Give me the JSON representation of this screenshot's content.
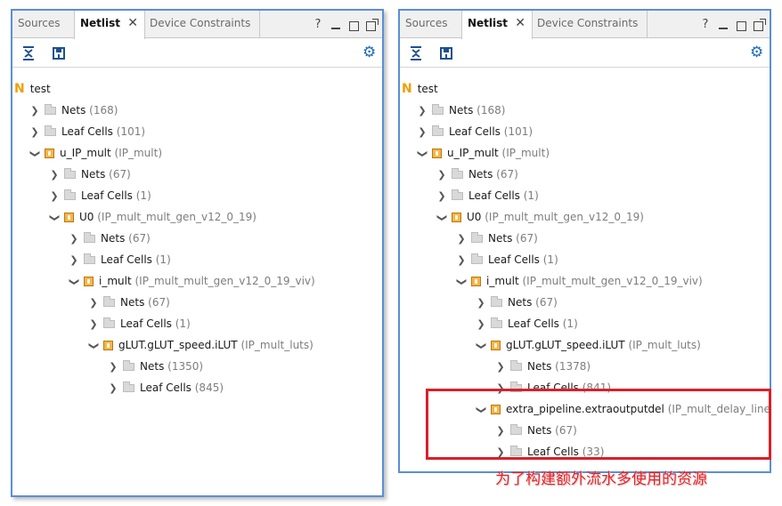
{
  "tabs": [
    {
      "label": "Sources",
      "active": false
    },
    {
      "label": "Netlist",
      "active": true
    },
    {
      "label": "Device Constraints",
      "active": false
    }
  ],
  "window_controls": {
    "help": "?"
  },
  "icons": {
    "collapse_all": "collapse-all-icon",
    "expand_all": "expand-all-icon",
    "settings": "gear-icon"
  },
  "left_tree": [
    {
      "depth": 0,
      "kind": "root",
      "label": "test",
      "extra": "",
      "expanded": true
    },
    {
      "depth": 1,
      "kind": "folder",
      "label": "Nets",
      "extra": "(168)",
      "expanded": false
    },
    {
      "depth": 1,
      "kind": "folder",
      "label": "Leaf Cells",
      "extra": "(101)",
      "expanded": false
    },
    {
      "depth": 1,
      "kind": "cell",
      "label": "u_IP_mult",
      "extra": "(IP_mult)",
      "expanded": true
    },
    {
      "depth": 2,
      "kind": "folder",
      "label": "Nets",
      "extra": "(67)",
      "expanded": false
    },
    {
      "depth": 2,
      "kind": "folder",
      "label": "Leaf Cells",
      "extra": "(1)",
      "expanded": false
    },
    {
      "depth": 2,
      "kind": "cell",
      "label": "U0",
      "extra": "(IP_mult_mult_gen_v12_0_19)",
      "expanded": true
    },
    {
      "depth": 3,
      "kind": "folder",
      "label": "Nets",
      "extra": "(67)",
      "expanded": false
    },
    {
      "depth": 3,
      "kind": "folder",
      "label": "Leaf Cells",
      "extra": "(1)",
      "expanded": false
    },
    {
      "depth": 3,
      "kind": "cell",
      "label": "i_mult",
      "extra": "(IP_mult_mult_gen_v12_0_19_viv)",
      "expanded": true
    },
    {
      "depth": 4,
      "kind": "folder",
      "label": "Nets",
      "extra": "(67)",
      "expanded": false
    },
    {
      "depth": 4,
      "kind": "folder",
      "label": "Leaf Cells",
      "extra": "(1)",
      "expanded": false
    },
    {
      "depth": 4,
      "kind": "cell",
      "label": "gLUT.gLUT_speed.iLUT",
      "extra": "(IP_mult_luts)",
      "expanded": true
    },
    {
      "depth": 5,
      "kind": "folder",
      "label": "Nets",
      "extra": "(1350)",
      "expanded": false
    },
    {
      "depth": 5,
      "kind": "folder",
      "label": "Leaf Cells",
      "extra": "(845)",
      "expanded": false
    }
  ],
  "right_tree": [
    {
      "depth": 0,
      "kind": "root",
      "label": "test",
      "extra": "",
      "expanded": true
    },
    {
      "depth": 1,
      "kind": "folder",
      "label": "Nets",
      "extra": "(168)",
      "expanded": false
    },
    {
      "depth": 1,
      "kind": "folder",
      "label": "Leaf Cells",
      "extra": "(101)",
      "expanded": false
    },
    {
      "depth": 1,
      "kind": "cell",
      "label": "u_IP_mult",
      "extra": "(IP_mult)",
      "expanded": true
    },
    {
      "depth": 2,
      "kind": "folder",
      "label": "Nets",
      "extra": "(67)",
      "expanded": false
    },
    {
      "depth": 2,
      "kind": "folder",
      "label": "Leaf Cells",
      "extra": "(1)",
      "expanded": false
    },
    {
      "depth": 2,
      "kind": "cell",
      "label": "U0",
      "extra": "(IP_mult_mult_gen_v12_0_19)",
      "expanded": true
    },
    {
      "depth": 3,
      "kind": "folder",
      "label": "Nets",
      "extra": "(67)",
      "expanded": false
    },
    {
      "depth": 3,
      "kind": "folder",
      "label": "Leaf Cells",
      "extra": "(1)",
      "expanded": false
    },
    {
      "depth": 3,
      "kind": "cell",
      "label": "i_mult",
      "extra": "(IP_mult_mult_gen_v12_0_19_viv)",
      "expanded": true
    },
    {
      "depth": 4,
      "kind": "folder",
      "label": "Nets",
      "extra": "(67)",
      "expanded": false
    },
    {
      "depth": 4,
      "kind": "folder",
      "label": "Leaf Cells",
      "extra": "(1)",
      "expanded": false
    },
    {
      "depth": 4,
      "kind": "cell",
      "label": "gLUT.gLUT_speed.iLUT",
      "extra": "(IP_mult_luts)",
      "expanded": true
    },
    {
      "depth": 5,
      "kind": "folder",
      "label": "Nets",
      "extra": "(1378)",
      "expanded": false
    },
    {
      "depth": 5,
      "kind": "folder",
      "label": "Leaf Cells",
      "extra": "(841)",
      "expanded": false
    },
    {
      "depth": 4,
      "kind": "cell",
      "label": "extra_pipeline.extraoutputdel",
      "extra": "(IP_mult_delay_line)",
      "expanded": true
    },
    {
      "depth": 5,
      "kind": "folder",
      "label": "Nets",
      "extra": "(67)",
      "expanded": false
    },
    {
      "depth": 5,
      "kind": "folder",
      "label": "Leaf Cells",
      "extra": "(33)",
      "expanded": false
    }
  ],
  "annotation": {
    "text": "为了构建额外流水多使用的资源",
    "color": "#d9202a"
  }
}
